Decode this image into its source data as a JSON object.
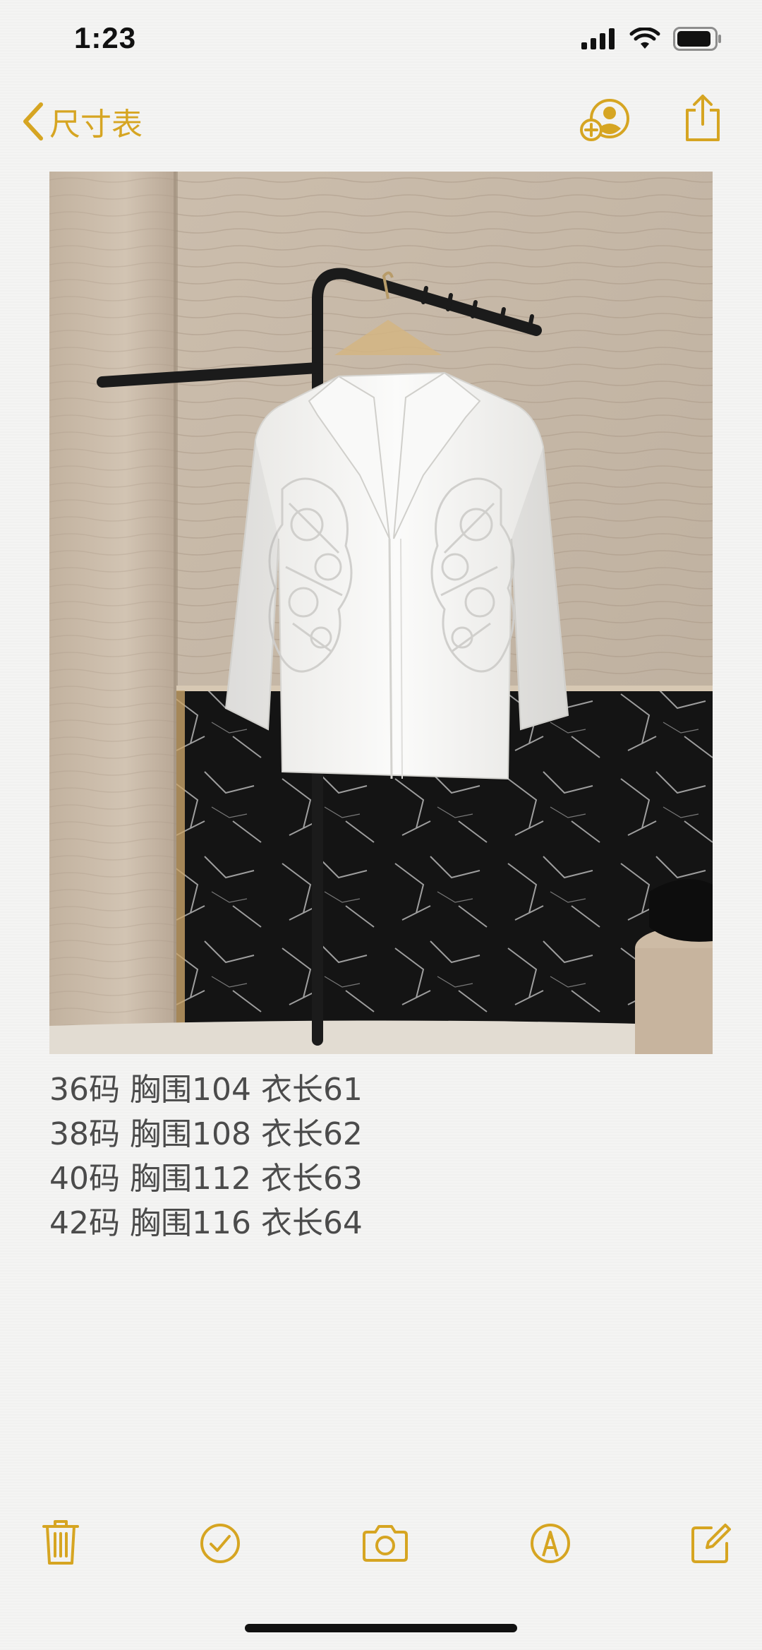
{
  "status_bar": {
    "time": "1:23",
    "icons": [
      "cellular-signal-icon",
      "wifi-icon",
      "battery-icon"
    ]
  },
  "nav": {
    "back_label": "尺寸表",
    "icons": [
      "add-person-icon",
      "share-icon"
    ]
  },
  "photo": {
    "description_name": "white-lace-blouse-photo"
  },
  "note": {
    "lines": [
      "36码 胸围104 衣长61",
      "38码 胸围108 衣长62",
      "40码 胸围112 衣长63",
      "42码 胸围116 衣长64"
    ]
  },
  "toolbar": {
    "icons": [
      "trash-icon",
      "checklist-icon",
      "camera-icon",
      "markup-pen-icon",
      "compose-icon"
    ]
  },
  "colors": {
    "accent": "#d6a522",
    "text": "#4b4b4b",
    "background": "#f4f4f3"
  }
}
